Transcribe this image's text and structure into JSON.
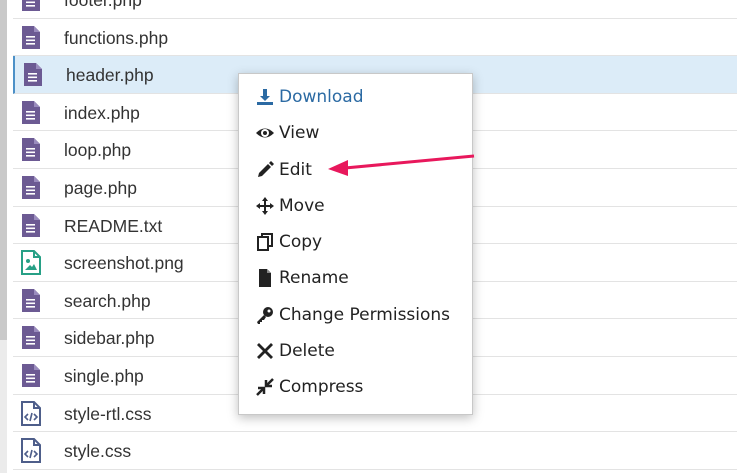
{
  "files": [
    {
      "name": "footer.php",
      "type": "doc"
    },
    {
      "name": "functions.php",
      "type": "doc"
    },
    {
      "name": "header.php",
      "type": "doc",
      "selected": true
    },
    {
      "name": "index.php",
      "type": "doc"
    },
    {
      "name": "loop.php",
      "type": "doc"
    },
    {
      "name": "page.php",
      "type": "doc"
    },
    {
      "name": "README.txt",
      "type": "doc"
    },
    {
      "name": "screenshot.png",
      "type": "image"
    },
    {
      "name": "search.php",
      "type": "doc"
    },
    {
      "name": "sidebar.php",
      "type": "doc"
    },
    {
      "name": "single.php",
      "type": "doc"
    },
    {
      "name": "style-rtl.css",
      "type": "code"
    },
    {
      "name": "style.css",
      "type": "code"
    }
  ],
  "context_menu": {
    "items": [
      {
        "label": "Download",
        "icon": "download-icon"
      },
      {
        "label": "View",
        "icon": "eye-icon"
      },
      {
        "label": "Edit",
        "icon": "pencil-icon"
      },
      {
        "label": "Move",
        "icon": "move-icon"
      },
      {
        "label": "Copy",
        "icon": "copy-icon"
      },
      {
        "label": "Rename",
        "icon": "file-icon"
      },
      {
        "label": "Change Permissions",
        "icon": "key-icon"
      },
      {
        "label": "Delete",
        "icon": "x-icon"
      },
      {
        "label": "Compress",
        "icon": "compress-icon"
      }
    ]
  },
  "colors": {
    "doc_icon": "#6c5a93",
    "image_icon": "#27a086",
    "code_icon": "#4e5e8a",
    "selected_row": "#dcecf8",
    "download_label": "#2b6aa3",
    "annotation_arrow": "#e8185c"
  }
}
